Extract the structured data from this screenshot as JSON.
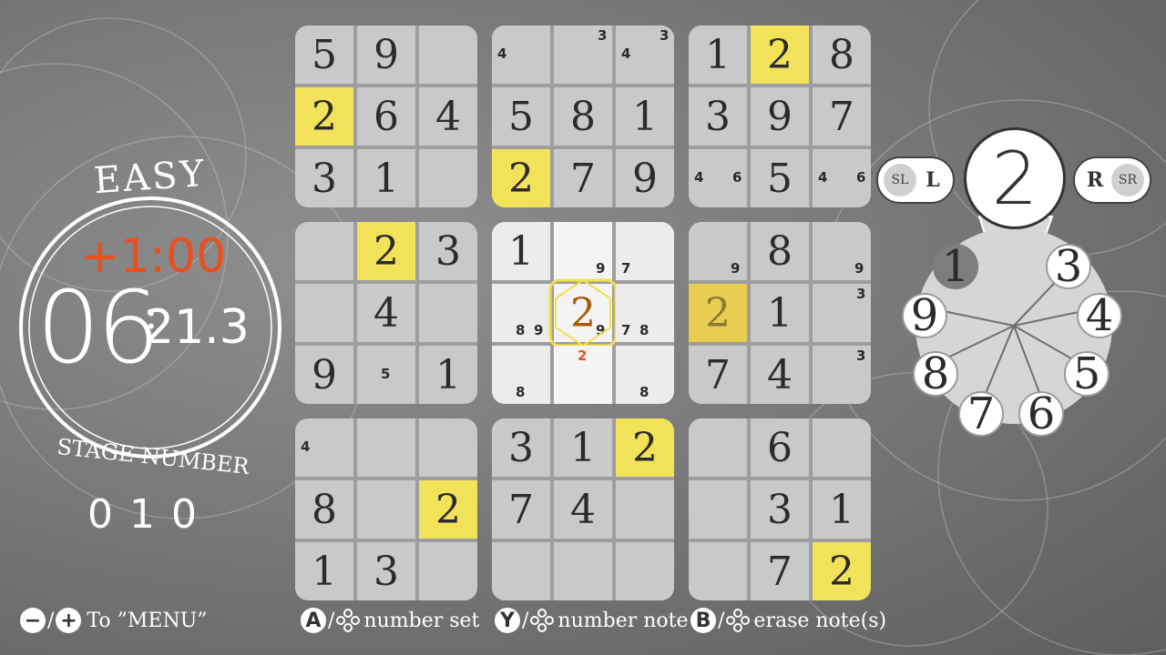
{
  "left_panel": {
    "difficulty": "EASY",
    "time_bonus": "+1:00",
    "timer_minutes": "06",
    "timer_seconds": "21.3",
    "stage_label": "STAGE NUMBER",
    "stage_number": "010"
  },
  "board": {
    "boxes": [
      {
        "cells": [
          {
            "v": "5"
          },
          {
            "v": "9"
          },
          {
            "v": ""
          },
          {
            "v": "2",
            "hl": true
          },
          {
            "v": "6"
          },
          {
            "v": "4"
          },
          {
            "v": "3"
          },
          {
            "v": "1"
          },
          {
            "v": ""
          }
        ]
      },
      {
        "cells": [
          {
            "v": "",
            "notes": [
              "4"
            ]
          },
          {
            "v": "",
            "notes": [
              "3"
            ]
          },
          {
            "v": "",
            "notes": [
              "4",
              "3"
            ]
          },
          {
            "v": "5"
          },
          {
            "v": "8"
          },
          {
            "v": "1"
          },
          {
            "v": "2",
            "hl": true
          },
          {
            "v": "7"
          },
          {
            "v": "9"
          }
        ]
      },
      {
        "cells": [
          {
            "v": "1"
          },
          {
            "v": "2",
            "hl": true
          },
          {
            "v": "8"
          },
          {
            "v": "3"
          },
          {
            "v": "9"
          },
          {
            "v": "7"
          },
          {
            "v": "",
            "notes": [
              "4",
              "6"
            ]
          },
          {
            "v": "5"
          },
          {
            "v": "",
            "notes": [
              "4",
              "6"
            ]
          }
        ]
      },
      {
        "cells": [
          {
            "v": ""
          },
          {
            "v": "2",
            "hl": true
          },
          {
            "v": "3"
          },
          {
            "v": ""
          },
          {
            "v": "4"
          },
          {
            "v": ""
          },
          {
            "v": "9"
          },
          {
            "v": "",
            "notes": [
              "5"
            ]
          },
          {
            "v": "1"
          }
        ]
      },
      {
        "cells": [
          {
            "v": "1"
          },
          {
            "v": "",
            "notes": [
              "9"
            ]
          },
          {
            "v": "",
            "notes": [
              "7"
            ]
          },
          {
            "v": "",
            "notes": [
              "8",
              "9"
            ]
          },
          {
            "v": "2",
            "sel": true,
            "notes": [
              "9"
            ]
          },
          {
            "v": "",
            "notes": [
              "7",
              "8"
            ]
          },
          {
            "v": "",
            "notes": [
              "8"
            ]
          },
          {
            "v": "",
            "notes": [
              "2"
            ],
            "red": true
          },
          {
            "v": "",
            "notes": [
              "8"
            ]
          }
        ]
      },
      {
        "cells": [
          {
            "v": "",
            "notes": [
              "9"
            ]
          },
          {
            "v": "8"
          },
          {
            "v": "",
            "notes": [
              "9"
            ]
          },
          {
            "v": "2",
            "hl2": true
          },
          {
            "v": "1"
          },
          {
            "v": "",
            "notes": [
              "3"
            ]
          },
          {
            "v": "7"
          },
          {
            "v": "4"
          },
          {
            "v": "",
            "notes": [
              "3"
            ]
          }
        ]
      },
      {
        "cells": [
          {
            "v": "",
            "notes": [
              "4"
            ]
          },
          {
            "v": ""
          },
          {
            "v": ""
          },
          {
            "v": "8"
          },
          {
            "v": ""
          },
          {
            "v": "2",
            "hl": true
          },
          {
            "v": "1"
          },
          {
            "v": "3"
          },
          {
            "v": ""
          }
        ]
      },
      {
        "cells": [
          {
            "v": "3"
          },
          {
            "v": "1"
          },
          {
            "v": "2",
            "hl": true
          },
          {
            "v": "7"
          },
          {
            "v": "4"
          },
          {
            "v": ""
          },
          {
            "v": ""
          },
          {
            "v": ""
          },
          {
            "v": ""
          }
        ]
      },
      {
        "cells": [
          {
            "v": ""
          },
          {
            "v": "6"
          },
          {
            "v": ""
          },
          {
            "v": ""
          },
          {
            "v": "3"
          },
          {
            "v": "1"
          },
          {
            "v": ""
          },
          {
            "v": "7"
          },
          {
            "v": "2",
            "hl": true
          }
        ]
      }
    ]
  },
  "right_panel": {
    "left_button_small": "SL",
    "left_button_big": "L",
    "right_button_big": "R",
    "right_button_small": "SR",
    "selected_number": "2",
    "wheel": [
      "1",
      "3",
      "4",
      "5",
      "6",
      "7",
      "8",
      "9"
    ]
  },
  "controls": {
    "minus_icon": "−",
    "plus_icon": "+",
    "menu_label": "To ”MENU”",
    "a_icon": "A",
    "number_set_label": "number set",
    "y_icon": "Y",
    "number_note_label": "number note",
    "b_icon": "B",
    "erase_label": "erase note(s)"
  }
}
